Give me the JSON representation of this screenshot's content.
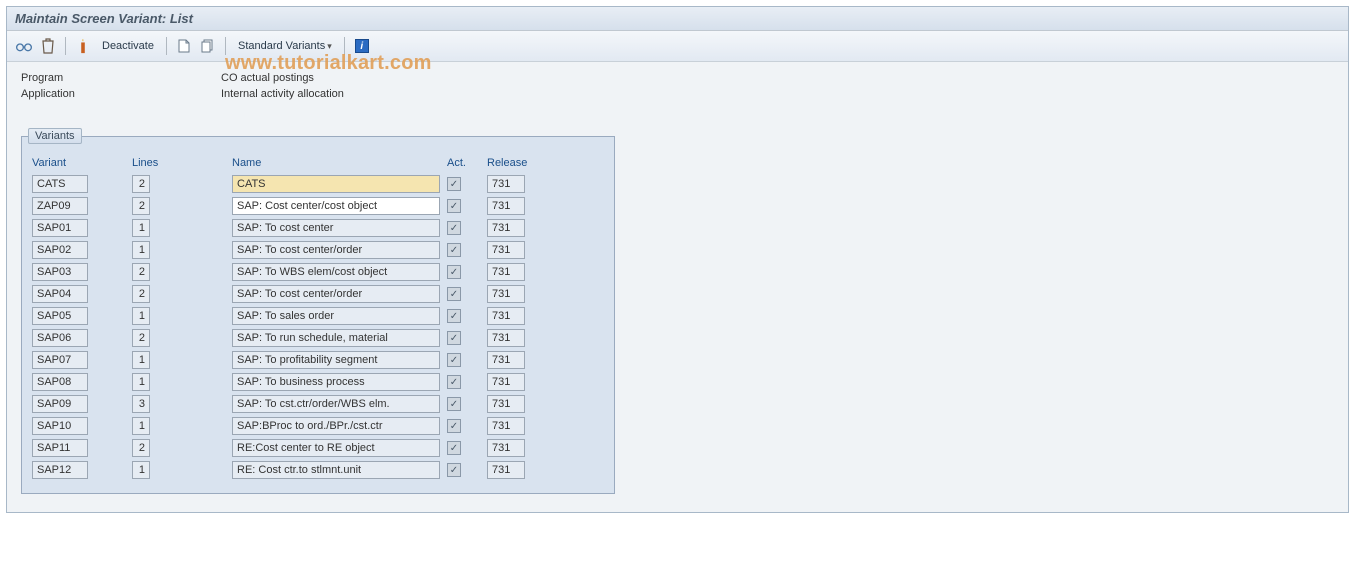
{
  "title": "Maintain Screen Variant: List",
  "toolbar": {
    "deactivate_label": "Deactivate",
    "standard_variants_label": "Standard Variants"
  },
  "info": {
    "program_label": "Program",
    "program_value": "CO actual postings",
    "application_label": "Application",
    "application_value": "Internal activity allocation"
  },
  "panel": {
    "title": "Variants",
    "headers": {
      "variant": "Variant",
      "lines": "Lines",
      "name": "Name",
      "act": "Act.",
      "release": "Release"
    },
    "rows": [
      {
        "variant": "CATS",
        "lines": "2",
        "name": "CATS",
        "act": true,
        "release": "731",
        "selected": true,
        "readonly": true
      },
      {
        "variant": "ZAP09",
        "lines": "2",
        "name": "SAP: Cost center/cost object",
        "act": true,
        "release": "731",
        "readonly": false
      },
      {
        "variant": "SAP01",
        "lines": "1",
        "name": "SAP: To cost center",
        "act": true,
        "release": "731",
        "readonly": true
      },
      {
        "variant": "SAP02",
        "lines": "1",
        "name": "SAP: To cost center/order",
        "act": true,
        "release": "731",
        "readonly": true
      },
      {
        "variant": "SAP03",
        "lines": "2",
        "name": "SAP: To WBS elem/cost object",
        "act": true,
        "release": "731",
        "readonly": true
      },
      {
        "variant": "SAP04",
        "lines": "2",
        "name": "SAP: To cost center/order",
        "act": true,
        "release": "731",
        "readonly": true
      },
      {
        "variant": "SAP05",
        "lines": "1",
        "name": "SAP: To sales order",
        "act": true,
        "release": "731",
        "readonly": true
      },
      {
        "variant": "SAP06",
        "lines": "2",
        "name": "SAP: To run schedule, material",
        "act": true,
        "release": "731",
        "readonly": true
      },
      {
        "variant": "SAP07",
        "lines": "1",
        "name": "SAP: To profitability segment",
        "act": true,
        "release": "731",
        "readonly": true
      },
      {
        "variant": "SAP08",
        "lines": "1",
        "name": "SAP: To business process",
        "act": true,
        "release": "731",
        "readonly": true
      },
      {
        "variant": "SAP09",
        "lines": "3",
        "name": "SAP: To cst.ctr/order/WBS elm.",
        "act": true,
        "release": "731",
        "readonly": true
      },
      {
        "variant": "SAP10",
        "lines": "1",
        "name": "SAP:BProc to ord./BPr./cst.ctr",
        "act": true,
        "release": "731",
        "readonly": true
      },
      {
        "variant": "SAP11",
        "lines": "2",
        "name": "RE:Cost center to RE object",
        "act": true,
        "release": "731",
        "readonly": true
      },
      {
        "variant": "SAP12",
        "lines": "1",
        "name": "RE: Cost ctr.to stlmnt.unit",
        "act": true,
        "release": "731",
        "readonly": true
      }
    ]
  },
  "watermark": "www.tutorialkart.com"
}
